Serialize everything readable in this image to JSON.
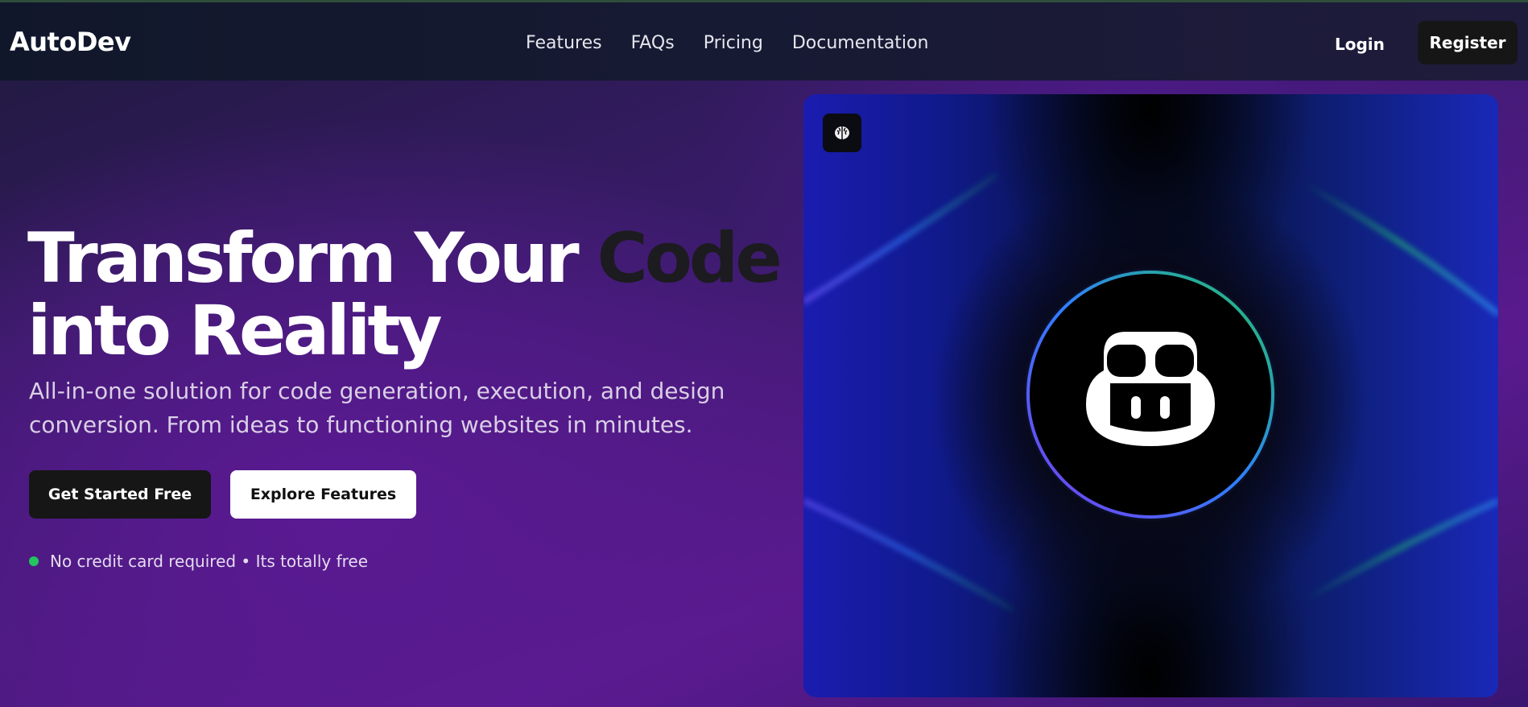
{
  "brand": {
    "name": "AutoDev"
  },
  "nav": {
    "links": [
      "Features",
      "FAQs",
      "Pricing",
      "Documentation"
    ],
    "login_label": "Login",
    "register_label": "Register"
  },
  "hero": {
    "title_part1": "Transform Your ",
    "title_accent": "Code",
    "title_part2": "into Reality",
    "subtitle": "All-in-one solution for code generation, execution, and design conversion. From ideas to functioning websites in minutes.",
    "primary_cta": "Get Started Free",
    "secondary_cta": "Explore Features",
    "note": "No credit card required • Its totally free"
  },
  "image_card": {
    "badge_icon": "brain-icon",
    "center_icon": "robot-face-icon"
  },
  "colors": {
    "accent_text": "#1c1b1f",
    "status_dot": "#22c55e",
    "ring_gradient": [
      "#22c55e",
      "#2f7fff",
      "#7c3aed"
    ]
  }
}
